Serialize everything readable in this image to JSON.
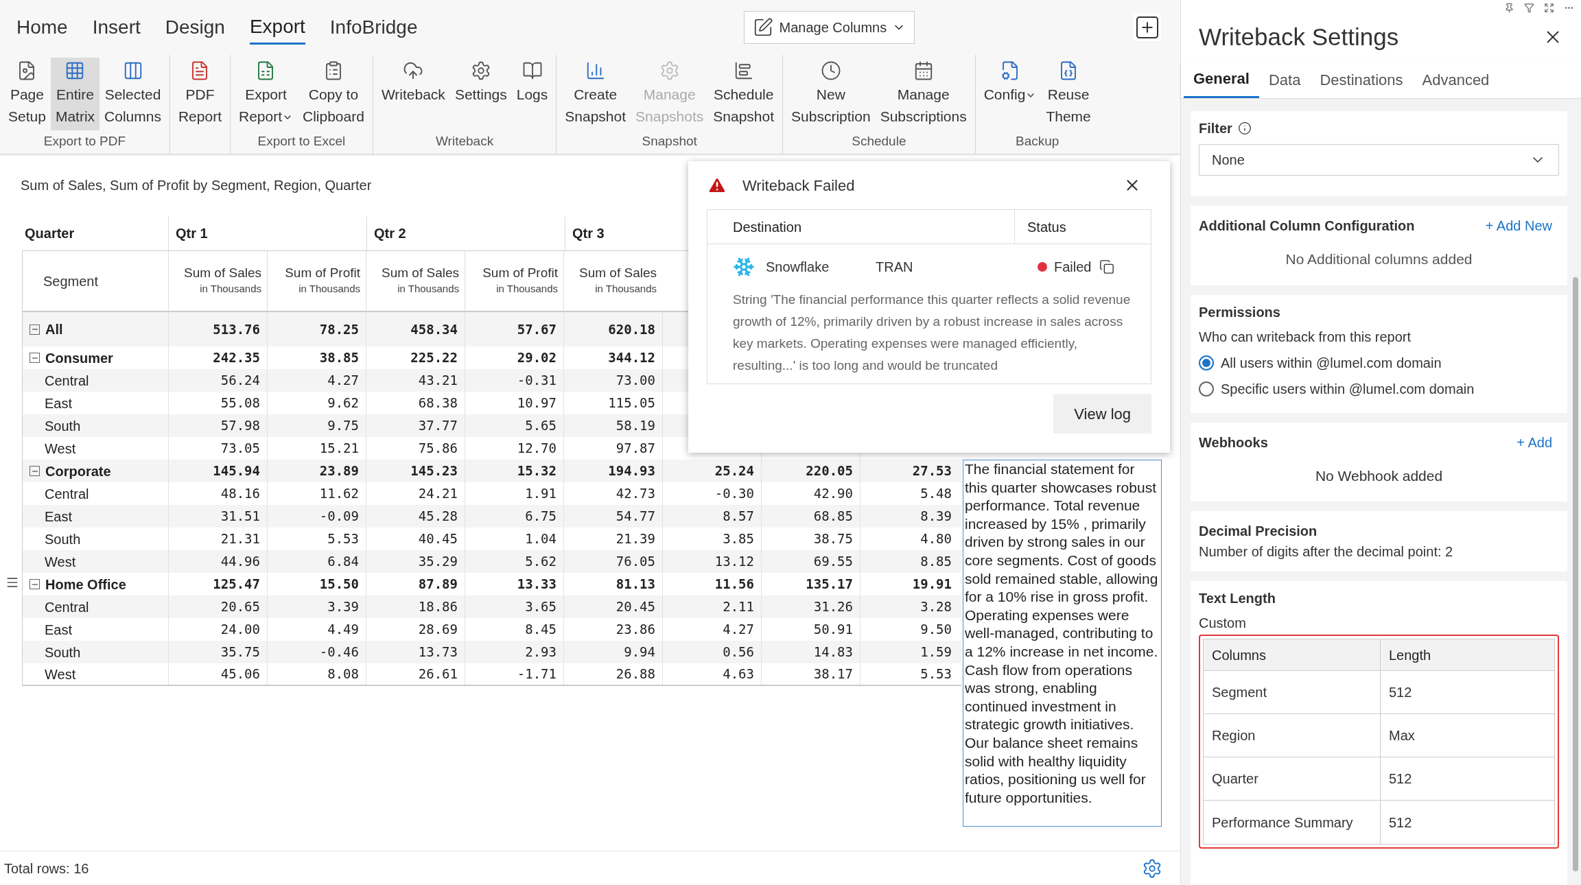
{
  "menu_tabs": [
    {
      "label": "Home",
      "selected": false
    },
    {
      "label": "Insert",
      "selected": false
    },
    {
      "label": "Design",
      "selected": false
    },
    {
      "label": "Export",
      "selected": true
    },
    {
      "label": "InfoBridge",
      "selected": false
    }
  ],
  "manage_columns": {
    "label": "Manage Columns"
  },
  "ribbon": [
    {
      "group": "Export to PDF",
      "items": [
        {
          "label": "Page\nSetup",
          "selected": false,
          "disabled": false
        },
        {
          "label": "Entire\nMatrix",
          "selected": true,
          "disabled": false
        },
        {
          "label": "Selected\nColumns",
          "selected": false,
          "disabled": false
        }
      ]
    },
    {
      "items": [
        {
          "label": "PDF\nReport",
          "selected": false,
          "disabled": false
        }
      ]
    },
    {
      "group": "Export to Excel",
      "items": [
        {
          "label": "Export\nReport",
          "selected": false,
          "disabled": false,
          "caret": true
        },
        {
          "label": "Copy to\nClipboard",
          "selected": false,
          "disabled": false
        }
      ]
    },
    {
      "group": "Writeback",
      "items": [
        {
          "label": "Writeback",
          "selected": false,
          "disabled": false
        },
        {
          "label": "Settings",
          "selected": false,
          "disabled": false
        },
        {
          "label": "Logs",
          "selected": false,
          "disabled": false
        }
      ]
    },
    {
      "group": "Snapshot",
      "items": [
        {
          "label": "Create\nSnapshot",
          "selected": false,
          "disabled": false
        },
        {
          "label": "Manage\nSnapshots",
          "selected": false,
          "disabled": true
        },
        {
          "label": "Schedule\nSnapshot",
          "selected": false,
          "disabled": false
        }
      ]
    },
    {
      "group": "Schedule",
      "items": [
        {
          "label": "New\nSubscription",
          "selected": false,
          "disabled": false
        },
        {
          "label": "Manage\nSubscriptions",
          "selected": false,
          "disabled": false
        }
      ]
    },
    {
      "group": "Backup",
      "items": [
        {
          "label": "Config",
          "selected": false,
          "disabled": false,
          "caret": true
        },
        {
          "label": "Reuse\nTheme",
          "selected": false,
          "disabled": false
        }
      ]
    }
  ],
  "visual_title": "Sum of Sales, Sum of Profit by Segment, Region, Quarter",
  "table": {
    "corner": "Quarter",
    "row_header": "Segment",
    "quarters": [
      "Qtr 1",
      "Qtr 2",
      "Qtr 3"
    ],
    "measures": [
      {
        "name": "Sum of Sales",
        "unit": "in Thousands"
      },
      {
        "name": "Sum of Profit",
        "unit": "in Thousands"
      },
      {
        "name": "Sum of Sales",
        "unit": "in Thousands"
      },
      {
        "name": "Sum of Profit",
        "unit": "in Thousands"
      },
      {
        "name": "Sum of Sales",
        "unit": "in Thousands"
      }
    ],
    "rows": [
      {
        "kind": "total",
        "label": "All",
        "expanded": true,
        "values": [
          "513.76",
          "78.25",
          "458.34",
          "57.67",
          "620.18"
        ]
      },
      {
        "kind": "group",
        "label": "Consumer",
        "expanded": true,
        "values": [
          "242.35",
          "38.85",
          "225.22",
          "29.02",
          "344.12"
        ]
      },
      {
        "kind": "region",
        "label": "Central",
        "values": [
          "56.24",
          "4.27",
          "43.21",
          "-0.31",
          "73.00"
        ]
      },
      {
        "kind": "region",
        "label": "East",
        "values": [
          "55.08",
          "9.62",
          "68.38",
          "10.97",
          "115.05"
        ]
      },
      {
        "kind": "region",
        "label": "South",
        "values": [
          "57.98",
          "9.75",
          "37.77",
          "5.65",
          "58.19"
        ]
      },
      {
        "kind": "region",
        "label": "West",
        "values": [
          "73.05",
          "15.21",
          "75.86",
          "12.70",
          "97.87"
        ]
      },
      {
        "kind": "group",
        "label": "Corporate",
        "expanded": true,
        "values": [
          "145.94",
          "23.89",
          "145.23",
          "15.32",
          "194.93",
          "25.24",
          "220.05",
          "27.53"
        ]
      },
      {
        "kind": "region",
        "label": "Central",
        "values": [
          "48.16",
          "11.62",
          "24.21",
          "1.91",
          "42.73",
          "-0.30",
          "42.90",
          "5.48"
        ]
      },
      {
        "kind": "region",
        "label": "East",
        "values": [
          "31.51",
          "-0.09",
          "45.28",
          "6.75",
          "54.77",
          "8.57",
          "68.85",
          "8.39"
        ]
      },
      {
        "kind": "region",
        "label": "South",
        "values": [
          "21.31",
          "5.53",
          "40.45",
          "1.04",
          "21.39",
          "3.85",
          "38.75",
          "4.80"
        ]
      },
      {
        "kind": "region",
        "label": "West",
        "values": [
          "44.96",
          "6.84",
          "35.29",
          "5.62",
          "76.05",
          "13.12",
          "69.55",
          "8.85"
        ]
      },
      {
        "kind": "group",
        "label": "Home Office",
        "expanded": true,
        "values": [
          "125.47",
          "15.50",
          "87.89",
          "13.33",
          "81.13",
          "11.56",
          "135.17",
          "19.91"
        ]
      },
      {
        "kind": "region",
        "label": "Central",
        "values": [
          "20.65",
          "3.39",
          "18.86",
          "3.65",
          "20.45",
          "2.11",
          "31.26",
          "3.28"
        ]
      },
      {
        "kind": "region",
        "label": "East",
        "values": [
          "24.00",
          "4.49",
          "28.69",
          "8.45",
          "23.86",
          "4.27",
          "50.91",
          "9.50"
        ]
      },
      {
        "kind": "region",
        "label": "South",
        "values": [
          "35.75",
          "-0.46",
          "13.73",
          "2.93",
          "9.94",
          "0.56",
          "14.83",
          "1.59"
        ]
      },
      {
        "kind": "region",
        "label": "West",
        "values": [
          "45.06",
          "8.08",
          "26.61",
          "-1.71",
          "26.88",
          "4.63",
          "38.17",
          "5.53"
        ]
      }
    ]
  },
  "summary_editor": {
    "value": "The financial statement for this quarter showcases robust performance. Total revenue increased by 15% , primarily driven by strong sales in our core segments. Cost of goods sold remained stable, allowing for a 10% rise in gross profit. Operating expenses were well-managed, contributing to a 12% increase in net income. Cash flow from operations was strong, enabling continued investment in strategic growth initiatives. Our balance sheet remains solid with healthy liquidity ratios, positioning us well for future opportunities."
  },
  "dialog": {
    "title": "Writeback Failed",
    "columns": [
      "Destination",
      "Status"
    ],
    "results": [
      {
        "destination": "Snowflake",
        "table": "TRAN",
        "status": "Failed",
        "color": "#e0313f",
        "message": "String 'The financial performance this quarter reflects a solid revenue growth of 12%, primarily driven by a robust increase in sales across key markets. Operating expenses were managed efficiently, resulting...' is too long and would be truncated"
      }
    ],
    "button": "View log"
  },
  "status_bar": {
    "text": "Total rows: 16"
  },
  "settings": {
    "title": "Writeback Settings",
    "tabs": [
      {
        "label": "General",
        "selected": true
      },
      {
        "label": "Data",
        "selected": false
      },
      {
        "label": "Destinations",
        "selected": false
      },
      {
        "label": "Advanced",
        "selected": false
      }
    ],
    "filter": {
      "label": "Filter",
      "value": "None"
    },
    "additional_columns": {
      "title": "Additional Column Configuration",
      "action": "+ Add New",
      "empty": "No Additional columns added"
    },
    "permissions": {
      "title": "Permissions",
      "subtitle": "Who can writeback from this report",
      "options": [
        {
          "label": "All users within @lumel.com domain",
          "selected": true
        },
        {
          "label": "Specific users within @lumel.com domain",
          "selected": false
        }
      ]
    },
    "webhooks": {
      "title": "Webhooks",
      "action": "+ Add",
      "empty": "No Webhook added"
    },
    "decimal_precision": {
      "title": "Decimal Precision",
      "text": "Number of digits after the decimal point: 2"
    },
    "text_length": {
      "title": "Text Length",
      "mode": "Custom",
      "columns": [
        "Columns",
        "Length"
      ],
      "rows": [
        {
          "column": "Segment",
          "length": "512"
        },
        {
          "column": "Region",
          "length": "Max"
        },
        {
          "column": "Quarter",
          "length": "512"
        },
        {
          "column": "Performance Summary",
          "length": "512"
        }
      ]
    }
  }
}
